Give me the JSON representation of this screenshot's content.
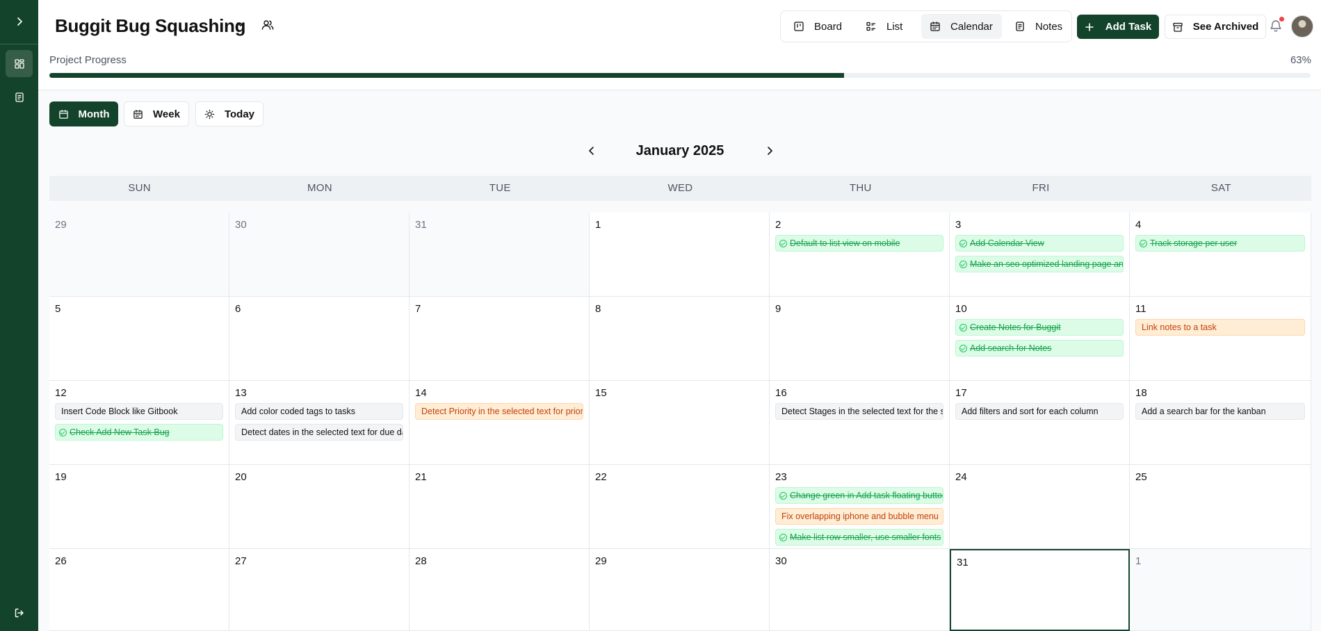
{
  "header": {
    "project_title": "Buggit Bug Squashing",
    "view_tabs": [
      {
        "label": "Board",
        "icon": "board-icon"
      },
      {
        "label": "List",
        "icon": "list-icon"
      },
      {
        "label": "Calendar",
        "icon": "calendar-icon",
        "active": true
      },
      {
        "label": "Notes",
        "icon": "notes-icon"
      }
    ],
    "add_task_label": "Add Task",
    "see_archived_label": "See Archived",
    "progress_label": "Project Progress",
    "progress_text": "63%",
    "progress_value": 0.63
  },
  "view_modes": [
    {
      "label": "Month",
      "active": true
    },
    {
      "label": "Week"
    },
    {
      "label": "Today"
    }
  ],
  "calendar": {
    "month_title": "January 2025",
    "weekdays": [
      "SUN",
      "MON",
      "TUE",
      "WED",
      "THU",
      "FRI",
      "SAT"
    ],
    "weeks": [
      [
        {
          "day": "29",
          "other": true,
          "tasks": []
        },
        {
          "day": "30",
          "other": true,
          "tasks": []
        },
        {
          "day": "31",
          "other": true,
          "tasks": []
        },
        {
          "day": "1",
          "tasks": []
        },
        {
          "day": "2",
          "tasks": [
            {
              "text": "Default to list view on mobile",
              "status": "done"
            }
          ]
        },
        {
          "day": "3",
          "tasks": [
            {
              "text": "Add Calendar View",
              "status": "done"
            },
            {
              "text": "Make an seo optimized landing page and",
              "status": "done"
            }
          ]
        },
        {
          "day": "4",
          "tasks": [
            {
              "text": "Track storage per user",
              "status": "done"
            }
          ]
        }
      ],
      [
        {
          "day": "5",
          "tasks": []
        },
        {
          "day": "6",
          "tasks": []
        },
        {
          "day": "7",
          "tasks": []
        },
        {
          "day": "8",
          "tasks": []
        },
        {
          "day": "9",
          "tasks": []
        },
        {
          "day": "10",
          "tasks": [
            {
              "text": "Create Notes for Buggit",
              "status": "done"
            },
            {
              "text": "Add search for Notes",
              "status": "done"
            }
          ]
        },
        {
          "day": "11",
          "tasks": [
            {
              "text": "Link notes to a task",
              "status": "prio"
            }
          ]
        }
      ],
      [
        {
          "day": "12",
          "tasks": [
            {
              "text": "Insert Code Block like Gitbook",
              "status": "todo"
            },
            {
              "text": "Check Add New Task Bug",
              "status": "done"
            }
          ]
        },
        {
          "day": "13",
          "tasks": [
            {
              "text": "Add color coded tags to tasks",
              "status": "todo"
            },
            {
              "text": "Detect dates in the selected text for due dates",
              "status": "todo"
            }
          ]
        },
        {
          "day": "14",
          "tasks": [
            {
              "text": "Detect Priority in the selected text for priority",
              "status": "prio"
            }
          ]
        },
        {
          "day": "15",
          "tasks": []
        },
        {
          "day": "16",
          "tasks": [
            {
              "text": "Detect Stages in the selected text for the stage",
              "status": "todo"
            }
          ]
        },
        {
          "day": "17",
          "tasks": [
            {
              "text": "Add filters and sort for each column",
              "status": "todo"
            }
          ]
        },
        {
          "day": "18",
          "tasks": [
            {
              "text": "Add a search bar for the kanban",
              "status": "todo"
            }
          ]
        }
      ],
      [
        {
          "day": "19",
          "tasks": []
        },
        {
          "day": "20",
          "tasks": []
        },
        {
          "day": "21",
          "tasks": []
        },
        {
          "day": "22",
          "tasks": []
        },
        {
          "day": "23",
          "tasks": [
            {
              "text": "Change green in Add task floating button",
              "status": "done"
            },
            {
              "text": "Fix overlapping iphone and bubble menu",
              "status": "prio"
            },
            {
              "text": "Make list row smaller, use smaller fonts",
              "status": "done"
            }
          ]
        },
        {
          "day": "24",
          "tasks": []
        },
        {
          "day": "25",
          "tasks": []
        }
      ],
      [
        {
          "day": "26",
          "tasks": []
        },
        {
          "day": "27",
          "tasks": []
        },
        {
          "day": "28",
          "tasks": []
        },
        {
          "day": "29",
          "tasks": []
        },
        {
          "day": "30",
          "tasks": []
        },
        {
          "day": "31",
          "today": true,
          "tasks": []
        },
        {
          "day": "1",
          "other": true,
          "tasks": []
        }
      ]
    ]
  }
}
